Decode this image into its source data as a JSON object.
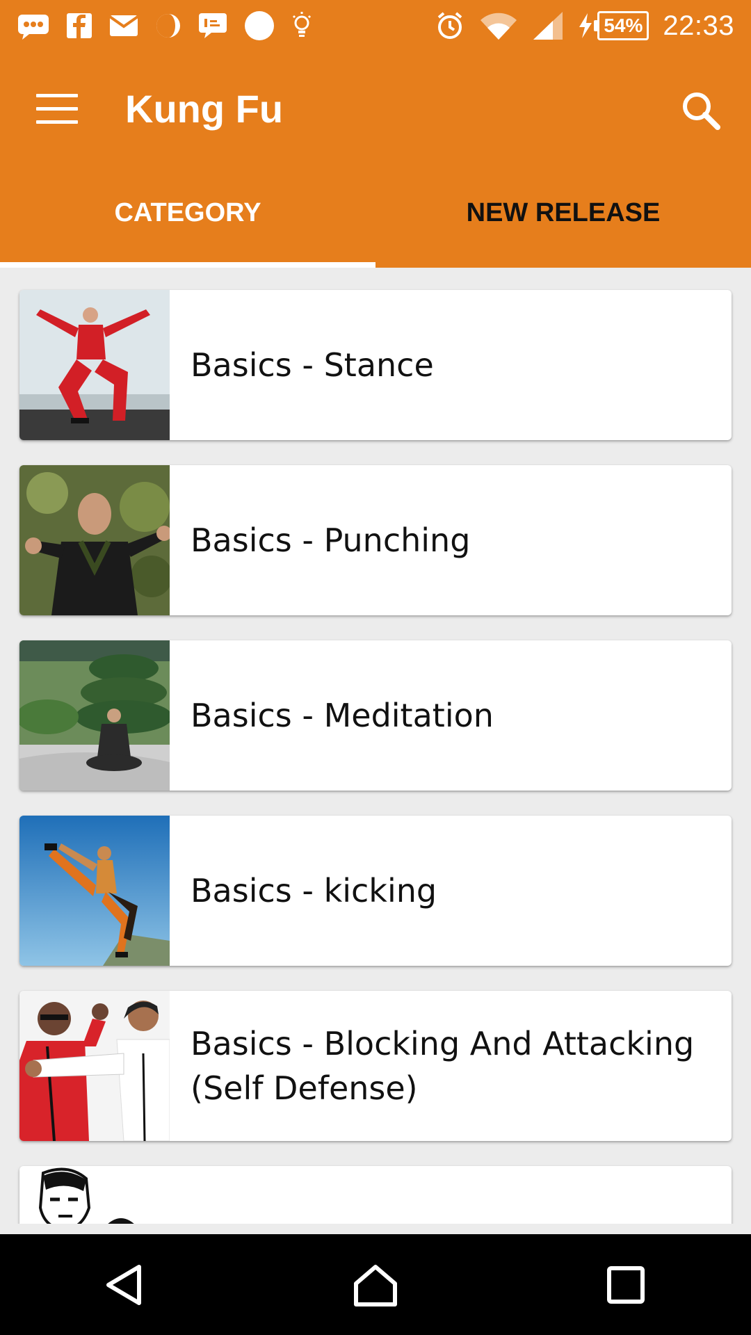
{
  "status_bar": {
    "battery": "54%",
    "time": "22:33"
  },
  "app_bar": {
    "title": "Kung Fu",
    "menu_icon": "hamburger-menu-icon",
    "search_icon": "search-icon"
  },
  "tabs": [
    {
      "label": "CATEGORY",
      "active": true
    },
    {
      "label": "NEW RELEASE",
      "active": false
    }
  ],
  "categories": [
    {
      "label": "Basics - Stance"
    },
    {
      "label": "Basics - Punching"
    },
    {
      "label": "Basics - Meditation"
    },
    {
      "label": "Basics - kicking"
    },
    {
      "label": "Basics - Blocking And Attacking (Self Defense)"
    },
    {
      "label": ""
    }
  ],
  "nav_bar": {
    "back_icon": "back-triangle-icon",
    "home_icon": "home-icon",
    "recents_icon": "recents-square-icon"
  },
  "colors": {
    "accent": "#e67e1c",
    "background": "#ececec",
    "card": "#ffffff"
  }
}
